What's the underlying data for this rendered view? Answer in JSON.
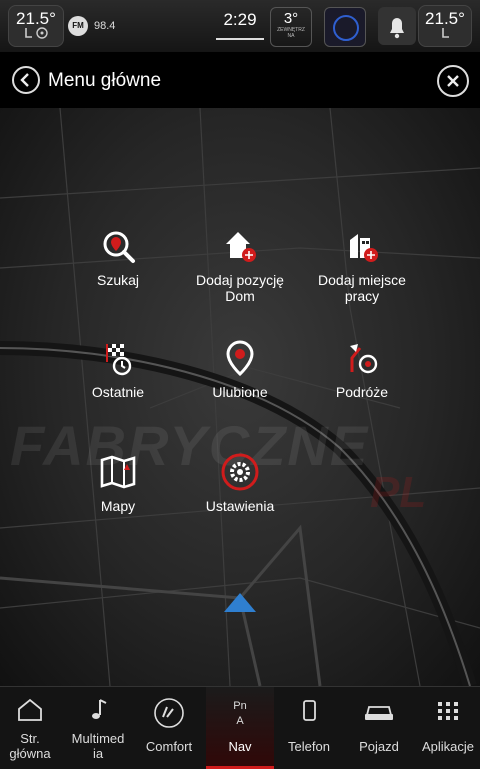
{
  "status_bar": {
    "left_temp": "21.5°",
    "radio_band": "FM",
    "radio_freq": "98.4",
    "clock": "2:29",
    "outside_temp": "3°",
    "outside_label_1": "ZEWNĘTRZ",
    "outside_label_2": "NA",
    "right_temp": "21.5°"
  },
  "header": {
    "title": "Menu główne"
  },
  "menu": {
    "items": [
      {
        "label": "Szukaj"
      },
      {
        "label": "Dodaj pozycję",
        "label2": "Dom"
      },
      {
        "label": "Dodaj miejsce",
        "label2": "pracy"
      },
      {
        "label": "Ostatnie"
      },
      {
        "label": "Ulubione"
      },
      {
        "label": "Podróże"
      },
      {
        "label": "Mapy"
      },
      {
        "label": "Ustawienia"
      }
    ]
  },
  "watermark": {
    "text": "FABRYCZNE",
    "text2": "PL"
  },
  "bottom_nav": {
    "items": [
      {
        "label": "Str.",
        "label2": "główna"
      },
      {
        "label": "Multimed",
        "label2": "ia"
      },
      {
        "label": "Comfort"
      },
      {
        "label": "Nav",
        "badge": "Pn",
        "badge2": "A"
      },
      {
        "label": "Telefon"
      },
      {
        "label": "Pojazd"
      },
      {
        "label": "Aplikacje"
      }
    ]
  },
  "colors": {
    "accent_red": "#d01c1c",
    "nav_blue": "#2f7fd0",
    "driver_ring": "#2f5fd0"
  }
}
